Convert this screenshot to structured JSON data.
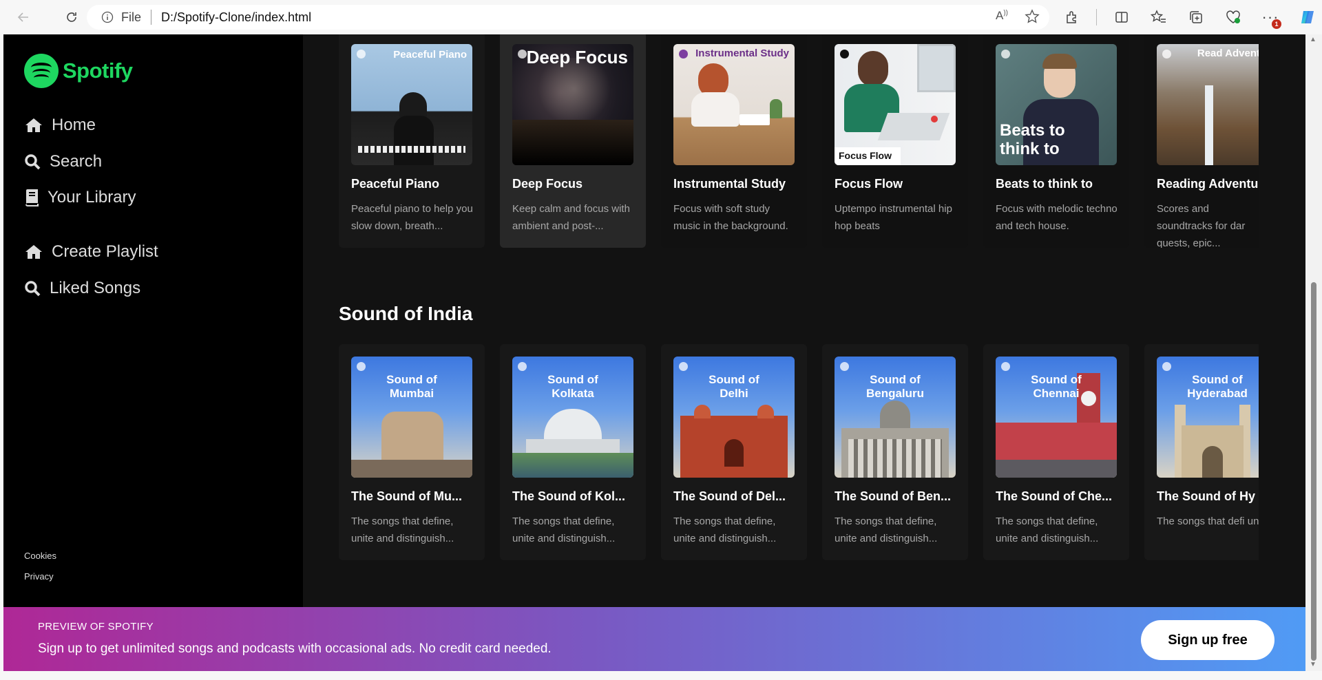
{
  "browser": {
    "scheme": "File",
    "url": "D:/Spotify-Clone/index.html",
    "notification_count": "1"
  },
  "sidebar": {
    "logo_text": "Spotify",
    "items": [
      {
        "label": "Home",
        "icon": "home-icon"
      },
      {
        "label": "Search",
        "icon": "search-icon"
      },
      {
        "label": "Your Library",
        "icon": "library-icon"
      },
      {
        "label": "Create Playlist",
        "icon": "home-icon"
      },
      {
        "label": "Liked Songs",
        "icon": "search-icon"
      }
    ],
    "footer": [
      "Cookies",
      "Privacy"
    ]
  },
  "focus_row": [
    {
      "title": "Peaceful Piano",
      "cover_text": "Peaceful Piano",
      "desc": "Peaceful piano to help you slow down, breath..."
    },
    {
      "title": "Deep Focus",
      "cover_text": "Deep Focus",
      "desc": "Keep calm and focus with ambient and post-..."
    },
    {
      "title": "Instrumental Study",
      "cover_text": "Instrumental Study",
      "desc": "Focus with soft study music in the background."
    },
    {
      "title": "Focus Flow",
      "cover_text": "Focus Flow",
      "desc": "Uptempo instrumental hip hop beats"
    },
    {
      "title": "Beats to think to",
      "cover_text": "Beats to think to",
      "desc": "Focus with melodic techno and tech house."
    },
    {
      "title": "Reading Adventu",
      "cover_text": "Read Advent",
      "desc": "Scores and soundtracks for dar quests, epic..."
    }
  ],
  "india_section": {
    "title": "Sound of India",
    "cards": [
      {
        "title": "The Sound of Mu...",
        "cover_line1": "Sound of",
        "cover_line2": "Mumbai",
        "desc": "The songs that define, unite and distinguish..."
      },
      {
        "title": "The Sound of Kol...",
        "cover_line1": "Sound of",
        "cover_line2": "Kolkata",
        "desc": "The songs that define, unite and distinguish..."
      },
      {
        "title": "The Sound of Del...",
        "cover_line1": "Sound of",
        "cover_line2": "Delhi",
        "desc": "The songs that define, unite and distinguish..."
      },
      {
        "title": "The Sound of Ben...",
        "cover_line1": "Sound of",
        "cover_line2": "Bengaluru",
        "desc": "The songs that define, unite and distinguish..."
      },
      {
        "title": "The Sound of Che...",
        "cover_line1": "Sound of",
        "cover_line2": "Chennai",
        "desc": "The songs that define, unite and distinguish..."
      },
      {
        "title": "The Sound of Hy",
        "cover_line1": "Sound of",
        "cover_line2": "Hyderabad",
        "desc": "The songs that defi unite and distinguis"
      }
    ]
  },
  "banner": {
    "tag": "PREVIEW OF SPOTIFY",
    "message": "Sign up to get unlimited songs and podcasts with occasional ads. No credit card needed.",
    "button": "Sign up free"
  },
  "colors": {
    "brand_green": "#1ed760",
    "background": "#121212",
    "card": "#181818"
  }
}
